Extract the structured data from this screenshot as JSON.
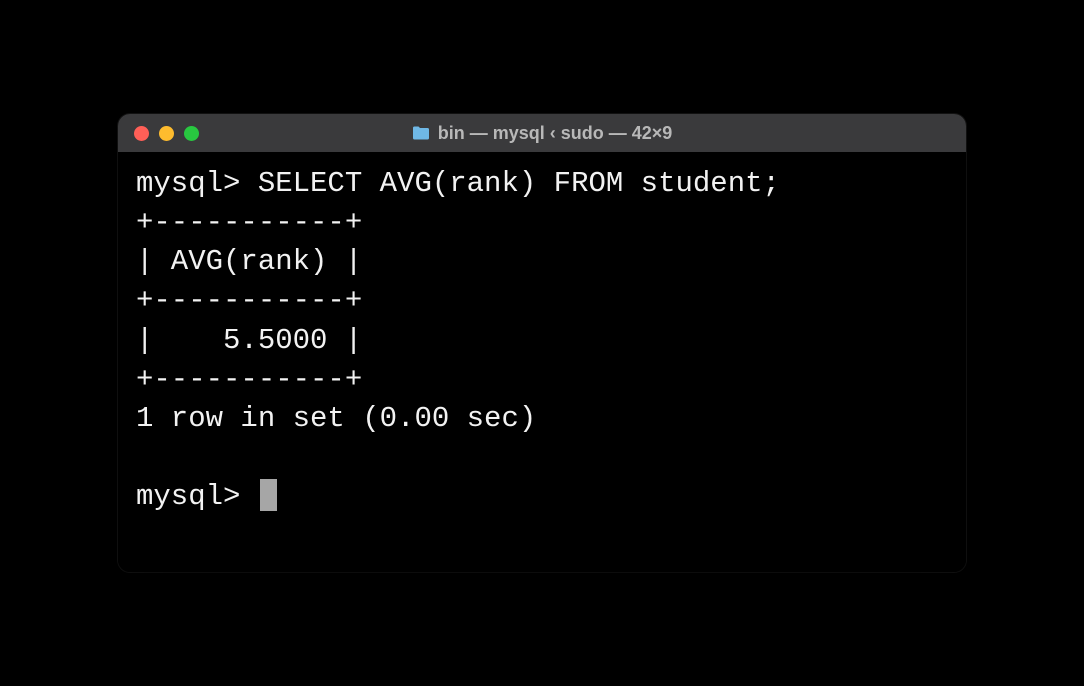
{
  "window": {
    "title": "bin — mysql ‹ sudo — 42×9"
  },
  "terminal": {
    "lines": [
      "mysql> SELECT AVG(rank) FROM student;",
      "+-----------+",
      "| AVG(rank) |",
      "+-----------+",
      "|    5.5000 |",
      "+-----------+",
      "1 row in set (0.00 sec)"
    ],
    "prompt": "mysql> "
  }
}
